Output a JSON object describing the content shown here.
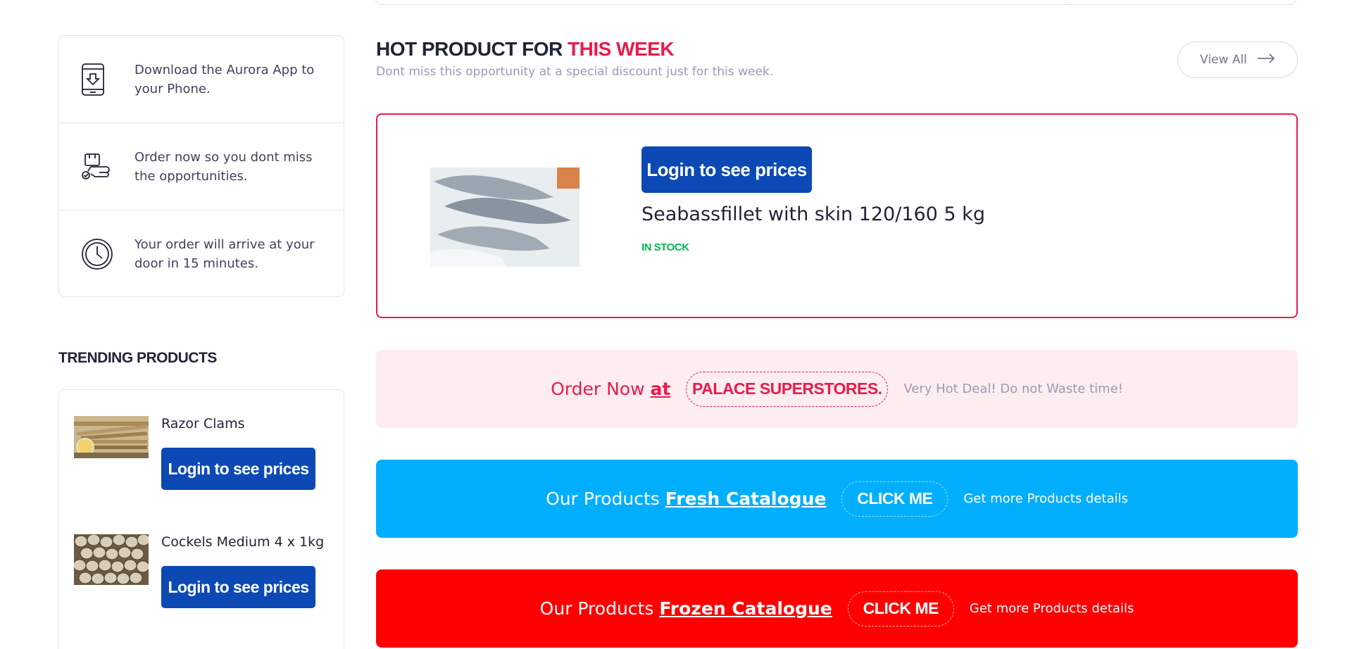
{
  "features": [
    {
      "icon": "phone-download-icon",
      "text": "Download the Aurora App to your Phone."
    },
    {
      "icon": "order-hand-icon",
      "text": "Order now so you dont miss the opportunities."
    },
    {
      "icon": "clock-icon",
      "text": "Your order will arrive at your door in 15 minutes."
    }
  ],
  "trending": {
    "title": "TRENDING PRODUCTS",
    "items": [
      {
        "name": "Razor Clams",
        "button": "Login to see prices"
      },
      {
        "name": "Cockels Medium 4 x 1kg",
        "button": "Login to see prices"
      }
    ]
  },
  "hot": {
    "title_main": "HOT PRODUCT FOR",
    "title_accent": "THIS WEEK",
    "subtitle": "Dont miss this opportunity at a special discount just for this week.",
    "view_all": "View All",
    "product": {
      "button": "Login to see prices",
      "name": "Seabassfillet with skin 120/160 5 kg",
      "stock": "IN STOCK"
    }
  },
  "banners": {
    "order": {
      "lead": "Order Now",
      "link": "at",
      "pill": "PALACE SUPERSTORES.",
      "tail": "Very Hot Deal! Do not Waste time!"
    },
    "fresh": {
      "lead": "Our Products",
      "link": "Fresh Catalogue",
      "pill": "CLICK ME",
      "tail": "Get more Products details"
    },
    "frozen": {
      "lead": "Our Products",
      "link": "Frozen Catalogue",
      "pill": "CLICK ME",
      "tail": "Get more Products details"
    }
  },
  "colors": {
    "accent": "#e91b4d",
    "button_blue": "#0c49b4",
    "in_stock": "#00b853",
    "fresh_banner": "#00aefe",
    "frozen_banner": "#ff0000",
    "order_banner_bg": "#fdedf0"
  }
}
